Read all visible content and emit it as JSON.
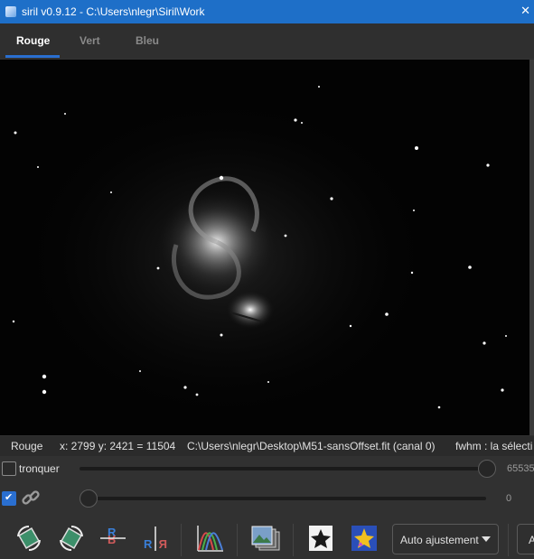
{
  "window": {
    "title": "siril v0.9.12 - C:\\Users\\nlegr\\Siril\\Work",
    "close_glyph": "✕"
  },
  "tabs": [
    {
      "label": "Rouge",
      "active": true
    },
    {
      "label": "Vert",
      "active": false
    },
    {
      "label": "Bleu",
      "active": false
    }
  ],
  "status": {
    "channel": "Rouge",
    "coords": "x: 2799 y: 2421 = 11504",
    "file": "C:\\Users\\nlegr\\Desktop\\M51-sansOffset.fit (canal 0)",
    "fwhm": "fwhm : la sélecti"
  },
  "high_slider": {
    "checkbox_label": "tronquer",
    "checked": false,
    "value": "65535",
    "level": 1.0
  },
  "low_slider": {
    "linked": true,
    "value": "0",
    "level": 0.0
  },
  "toolbar": {
    "icons": [
      "rotate-left-icon",
      "rotate-right-icon",
      "mirror-x-icon",
      "mirror-y-icon",
      "histogram-icon",
      "image-stack-icon",
      "star-negative-icon",
      "star-color-icon"
    ],
    "display_mode": "Auto ajustement",
    "next_button": "A"
  },
  "colors": {
    "accent": "#2a6fd0",
    "titlebar": "#1e6fc8",
    "background": "#313131"
  }
}
